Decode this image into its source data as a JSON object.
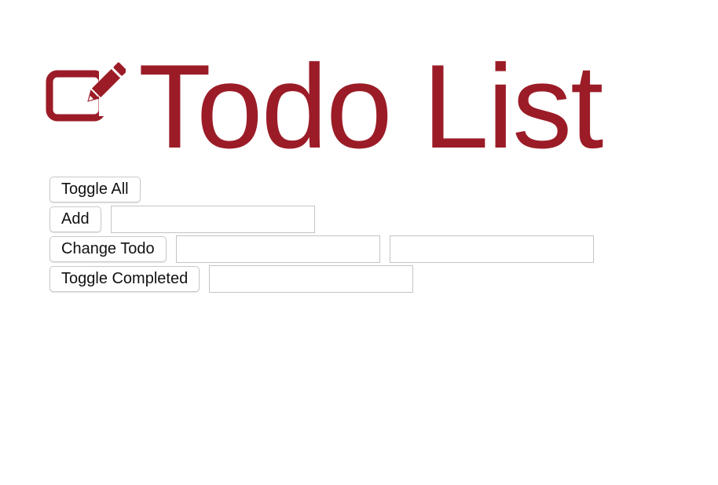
{
  "app": {
    "title": "Todo List",
    "accent_color": "#9b1c27",
    "logo_icon": "edit-square-icon"
  },
  "controls": {
    "toggle_all_label": "Toggle All",
    "add_label": "Add",
    "add_input": {
      "value": "",
      "placeholder": ""
    },
    "change_todo_label": "Change Todo",
    "change_todo_position_input": {
      "value": "",
      "placeholder": ""
    },
    "change_todo_text_input": {
      "value": "",
      "placeholder": ""
    },
    "toggle_completed_label": "Toggle Completed",
    "toggle_completed_input": {
      "value": "",
      "placeholder": ""
    }
  }
}
